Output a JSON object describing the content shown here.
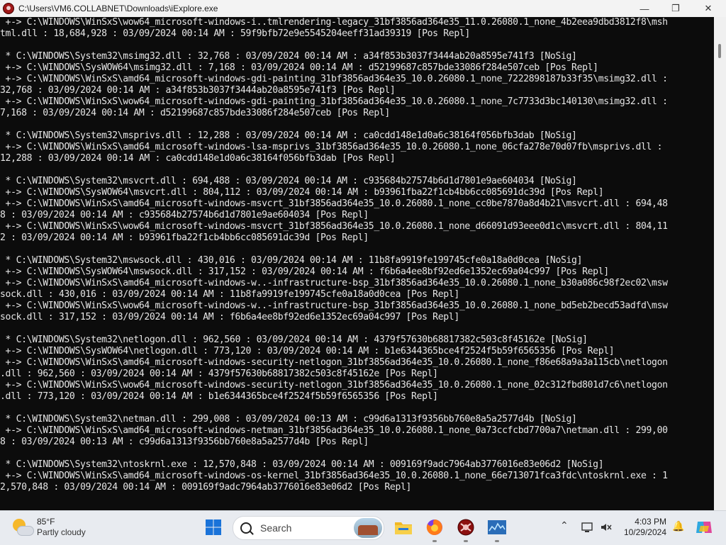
{
  "window": {
    "title": "C:\\Users\\VM6.COLLABNET\\Downloads\\iExplore.exe",
    "minimize_glyph": "—",
    "maximize_glyph": "❐",
    "close_glyph": "✕"
  },
  "console": {
    "lines": [
      " +-> C:\\WINDOWS\\WinSxS\\wow64_microsoft-windows-i..tmlrendering-legacy_31bf3856ad364e35_11.0.26080.1_none_4b2eea9dbd3812f8\\msh",
      "tml.dll : 18,684,928 : 03/09/2024 00:14 AM : 59f9bfb72e9e5545204eeff31ad39319 [Pos Repl]",
      "",
      " * C:\\WINDOWS\\System32\\msimg32.dll : 32,768 : 03/09/2024 00:14 AM : a34f853b3037f3444ab20a8595e741f3 [NoSig]",
      " +-> C:\\WINDOWS\\SysWOW64\\msimg32.dll : 7,168 : 03/09/2024 00:14 AM : d52199687c857bde33086f284e507ceb [Pos Repl]",
      " +-> C:\\WINDOWS\\WinSxS\\amd64_microsoft-windows-gdi-painting_31bf3856ad364e35_10.0.26080.1_none_7222898187b33f35\\msimg32.dll :",
      "32,768 : 03/09/2024 00:14 AM : a34f853b3037f3444ab20a8595e741f3 [Pos Repl]",
      " +-> C:\\WINDOWS\\WinSxS\\wow64_microsoft-windows-gdi-painting_31bf3856ad364e35_10.0.26080.1_none_7c7733d3bc140130\\msimg32.dll :",
      "7,168 : 03/09/2024 00:14 AM : d52199687c857bde33086f284e507ceb [Pos Repl]",
      "",
      " * C:\\WINDOWS\\System32\\msprivs.dll : 12,288 : 03/09/2024 00:14 AM : ca0cdd148e1d0a6c38164f056bfb3dab [NoSig]",
      " +-> C:\\WINDOWS\\WinSxS\\amd64_microsoft-windows-lsa-msprivs_31bf3856ad364e35_10.0.26080.1_none_06cfa278e70d07fb\\msprivs.dll :",
      "12,288 : 03/09/2024 00:14 AM : ca0cdd148e1d0a6c38164f056bfb3dab [Pos Repl]",
      "",
      " * C:\\WINDOWS\\System32\\msvcrt.dll : 694,488 : 03/09/2024 00:14 AM : c935684b27574b6d1d7801e9ae604034 [NoSig]",
      " +-> C:\\WINDOWS\\SysWOW64\\msvcrt.dll : 804,112 : 03/09/2024 00:14 AM : b93961fba22f1cb4bb6cc085691dc39d [Pos Repl]",
      " +-> C:\\WINDOWS\\WinSxS\\amd64_microsoft-windows-msvcrt_31bf3856ad364e35_10.0.26080.1_none_cc0be7870a8d4b21\\msvcrt.dll : 694,48",
      "8 : 03/09/2024 00:14 AM : c935684b27574b6d1d7801e9ae604034 [Pos Repl]",
      " +-> C:\\WINDOWS\\WinSxS\\wow64_microsoft-windows-msvcrt_31bf3856ad364e35_10.0.26080.1_none_d66091d93eee0d1c\\msvcrt.dll : 804,11",
      "2 : 03/09/2024 00:14 AM : b93961fba22f1cb4bb6cc085691dc39d [Pos Repl]",
      "",
      " * C:\\WINDOWS\\System32\\mswsock.dll : 430,016 : 03/09/2024 00:14 AM : 11b8fa9919fe199745cfe0a18a0d0cea [NoSig]",
      " +-> C:\\WINDOWS\\SysWOW64\\mswsock.dll : 317,152 : 03/09/2024 00:14 AM : f6b6a4ee8bf92ed6e1352ec69a04c997 [Pos Repl]",
      " +-> C:\\WINDOWS\\WinSxS\\amd64_microsoft-windows-w..-infrastructure-bsp_31bf3856ad364e35_10.0.26080.1_none_b30a086c98f2ec02\\msw",
      "sock.dll : 430,016 : 03/09/2024 00:14 AM : 11b8fa9919fe199745cfe0a18a0d0cea [Pos Repl]",
      " +-> C:\\WINDOWS\\WinSxS\\wow64_microsoft-windows-w..-infrastructure-bsp_31bf3856ad364e35_10.0.26080.1_none_bd5eb2becd53adfd\\msw",
      "sock.dll : 317,152 : 03/09/2024 00:14 AM : f6b6a4ee8bf92ed6e1352ec69a04c997 [Pos Repl]",
      "",
      " * C:\\WINDOWS\\System32\\netlogon.dll : 962,560 : 03/09/2024 00:14 AM : 4379f57630b68817382c503c8f45162e [NoSig]",
      " +-> C:\\WINDOWS\\SysWOW64\\netlogon.dll : 773,120 : 03/09/2024 00:14 AM : b1e6344365bce4f2524f5b59f6565356 [Pos Repl]",
      " +-> C:\\WINDOWS\\WinSxS\\amd64_microsoft-windows-security-netlogon_31bf3856ad364e35_10.0.26080.1_none_f86e68a9a3a115cb\\netlogon",
      ".dll : 962,560 : 03/09/2024 00:14 AM : 4379f57630b68817382c503c8f45162e [Pos Repl]",
      " +-> C:\\WINDOWS\\WinSxS\\wow64_microsoft-windows-security-netlogon_31bf3856ad364e35_10.0.26080.1_none_02c312fbd801d7c6\\netlogon",
      ".dll : 773,120 : 03/09/2024 00:14 AM : b1e6344365bce4f2524f5b59f6565356 [Pos Repl]",
      "",
      " * C:\\WINDOWS\\System32\\netman.dll : 299,008 : 03/09/2024 00:13 AM : c99d6a1313f9356bb760e8a5a2577d4b [NoSig]",
      " +-> C:\\WINDOWS\\WinSxS\\amd64_microsoft-windows-netman_31bf3856ad364e35_10.0.26080.1_none_0a73ccfcbd7700a7\\netman.dll : 299,00",
      "8 : 03/09/2024 00:13 AM : c99d6a1313f9356bb760e8a5a2577d4b [Pos Repl]",
      "",
      " * C:\\WINDOWS\\System32\\ntoskrnl.exe : 12,570,848 : 03/09/2024 00:14 AM : 009169f9adc7964ab3776016e83e06d2 [NoSig]",
      " +-> C:\\WINDOWS\\WinSxS\\amd64_microsoft-windows-os-kernel_31bf3856ad364e35_10.0.26080.1_none_66e713071fca3fdc\\ntoskrnl.exe : 1",
      "2,570,848 : 03/09/2024 00:14 AM : 009169f9adc7964ab3776016e83e06d2 [Pos Repl]"
    ]
  },
  "taskbar": {
    "weather": {
      "temp": "85°F",
      "condition": "Partly cloudy"
    },
    "search_label": "Search",
    "clock": {
      "time": "4:03 PM",
      "date": "10/29/2024"
    },
    "tray_chevron": "⌃",
    "notification_glyph": "🔔"
  }
}
